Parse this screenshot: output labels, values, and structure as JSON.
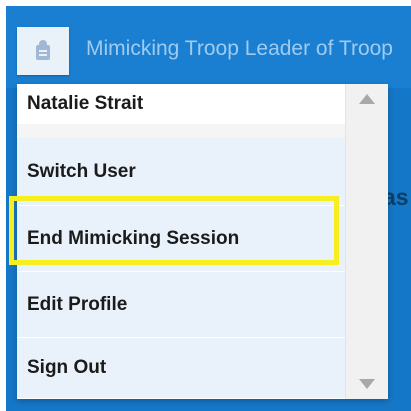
{
  "header": {
    "icon": "user-badge-icon",
    "title": "Mimicking Troop Leader of Troop"
  },
  "background": {
    "partial_text": "as"
  },
  "menu": {
    "user_name": "Natalie Strait",
    "items": [
      {
        "label": "Switch User"
      },
      {
        "label": "End Mimicking Session",
        "highlighted": true
      },
      {
        "label": "Edit Profile"
      },
      {
        "label": "Sign Out"
      }
    ]
  },
  "colors": {
    "header_blue": "#1a7fd0",
    "menu_item_bg": "#e9f1fa",
    "highlight": "#f6ee1e"
  }
}
